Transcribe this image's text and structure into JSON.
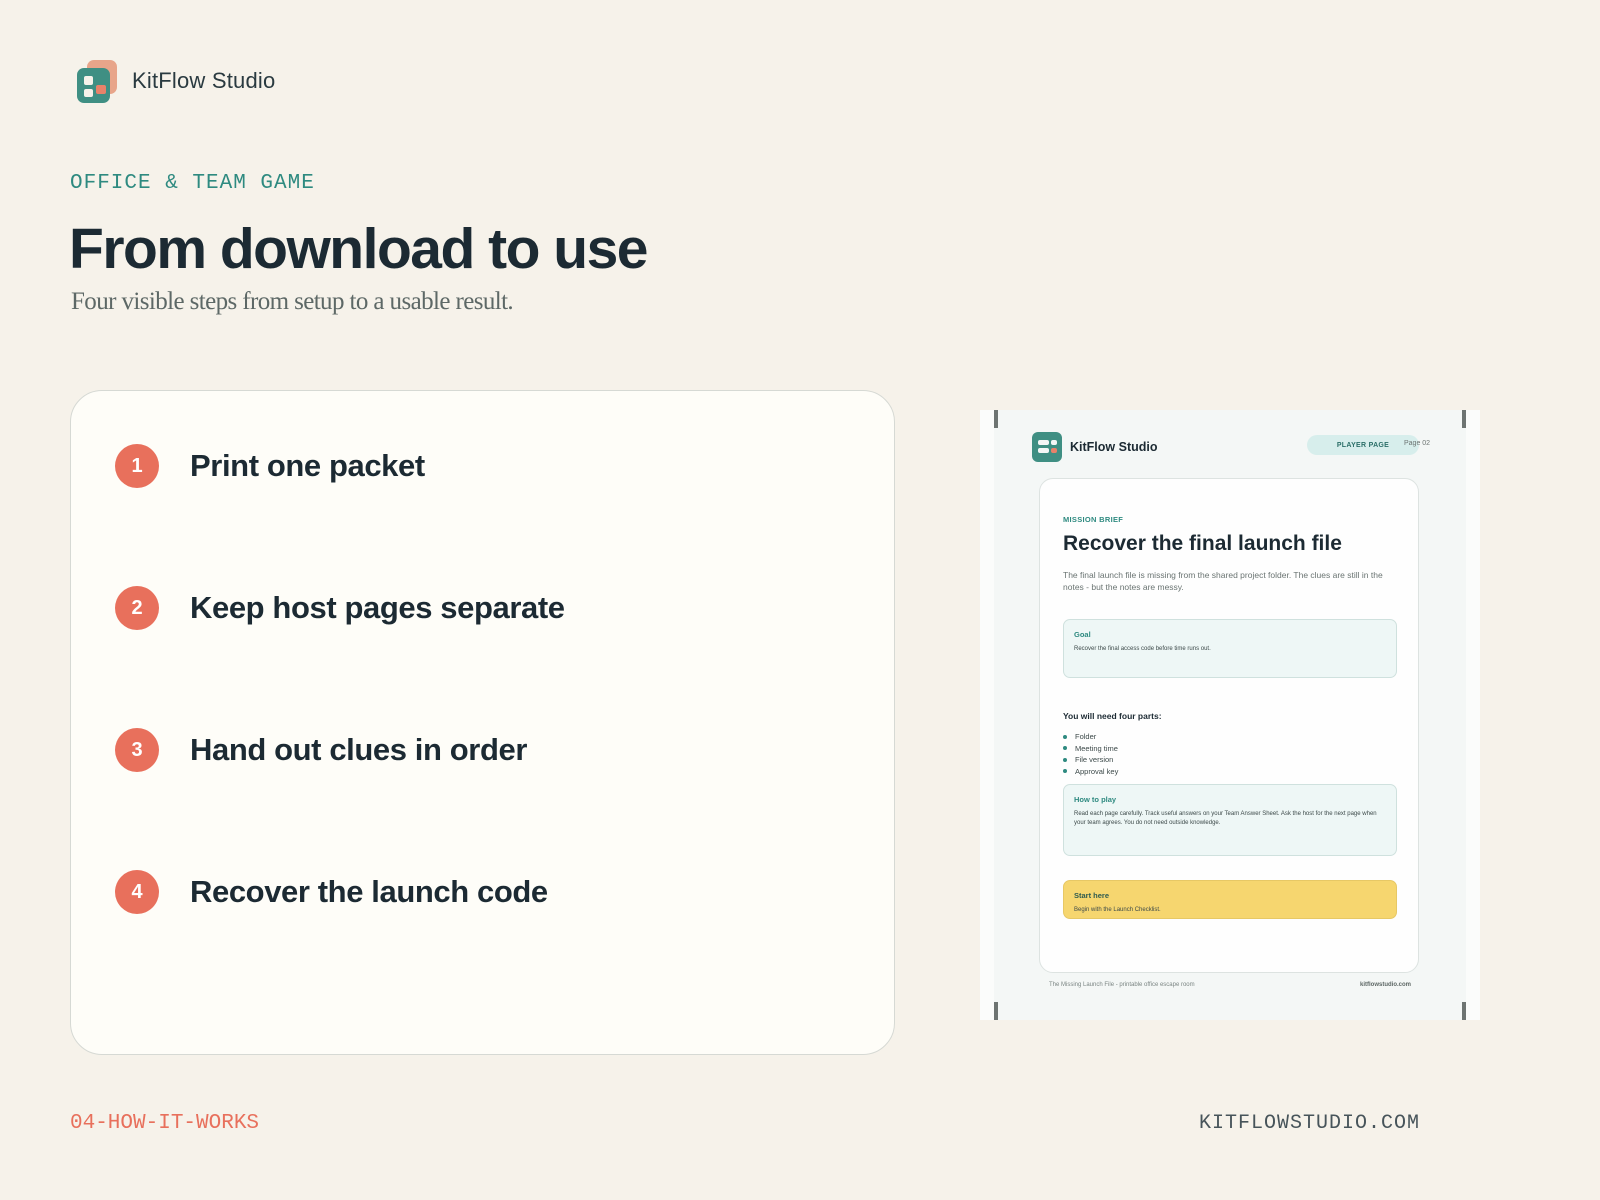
{
  "header": {
    "brand_name": "KitFlow Studio",
    "logo_icon": "kitflow-logo-icon"
  },
  "hero": {
    "eyebrow": "OFFICE & TEAM GAME",
    "title": "From download to use",
    "subtitle": "Four visible steps from setup to a usable result."
  },
  "steps": [
    {
      "number": "1",
      "label": "Print one packet"
    },
    {
      "number": "2",
      "label": "Keep host pages separate"
    },
    {
      "number": "3",
      "label": "Hand out clues in order"
    },
    {
      "number": "4",
      "label": "Recover the launch code"
    }
  ],
  "preview": {
    "brand_name": "KitFlow Studio",
    "badge": "PLAYER PAGE",
    "page_label": "Page 02",
    "eyebrow": "MISSION BRIEF",
    "title": "Recover the final launch file",
    "intro": "The final launch file is missing from the shared project folder. The clues are still in the notes - but the notes are messy.",
    "goal": {
      "title": "Goal",
      "text": "Recover the final access code before time runs out."
    },
    "parts_heading": "You will need four parts:",
    "parts": [
      "Folder",
      "Meeting time",
      "File version",
      "Approval key"
    ],
    "how_to_play": {
      "title": "How to play",
      "text": "Read each page carefully. Track useful answers on your Team Answer Sheet. Ask the host for the next page when your team agrees. You do not need outside knowledge."
    },
    "start_here": {
      "title": "Start here",
      "text": "Begin with the Launch Checklist."
    },
    "footer_left": "The Missing Launch File - printable office escape room",
    "footer_right": "kitflowstudio.com"
  },
  "footer": {
    "slide_id": "04-HOW-IT-WORKS",
    "website": "KITFLOWSTUDIO.COM"
  },
  "colors": {
    "background": "#f6f2ea",
    "accent_teal": "#3f8f83",
    "accent_coral": "#e8705c",
    "highlight_yellow": "#f6d66f",
    "text_dark": "#1c2a33"
  }
}
